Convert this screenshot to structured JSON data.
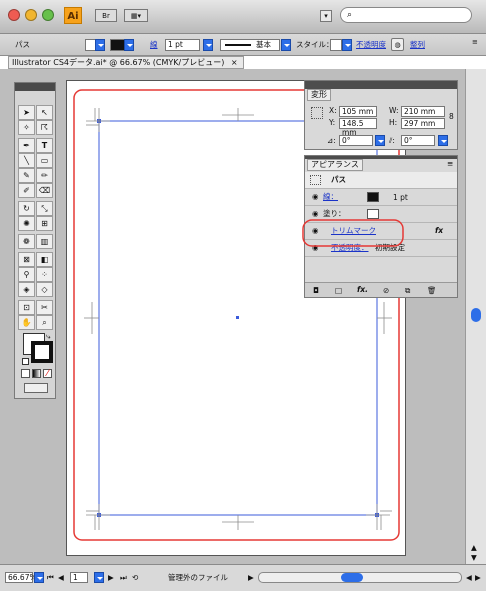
{
  "title_bar": {
    "app_icon_label": "Ai",
    "search_glyph": "⌕",
    "icons": [
      "close-light",
      "minimize-light",
      "zoom-light",
      "bridge-icon",
      "arrange-documents-icon",
      "search-icon"
    ]
  },
  "control_bar": {
    "object_type": "パス",
    "stroke_link": "線",
    "stroke_weight": "1 pt",
    "brush_label": "基本",
    "style_label": "スタイル：",
    "opacity_link": "不透明度",
    "recolor_link": "整列"
  },
  "document": {
    "tab_title": "Illustrator CS4データ.ai* @ 66.67% (CMYK/プレビュー)",
    "tab_close": "×"
  },
  "transform_panel": {
    "tab_label": "変形",
    "x_label": "X:",
    "x_value": "105 mm",
    "y_label": "Y:",
    "y_value": "148.5 mm",
    "w_label": "W:",
    "w_value": "210 mm",
    "h_label": "H:",
    "h_value": "297 mm",
    "angle_value": "0°",
    "shear_value": "0°"
  },
  "appearance_panel": {
    "tab_label": "アピアランス",
    "object_label": "パス",
    "stroke_label": "線：",
    "stroke_weight": "1 pt",
    "fill_label": "塗り：",
    "effect_label": "トリムマーク",
    "effect_fx": "fx",
    "opacity_label": "不透明度：",
    "opacity_value": "初期設定",
    "footer_fx": "fx."
  },
  "status_bar": {
    "zoom": "66.67%",
    "page": "1",
    "status_text": "管理外のファイル"
  },
  "colors": {
    "highlight": "#e53935",
    "artboard_guide": "#3b5bdb",
    "link": "#1a33c8",
    "accent_blue": "#2d6ee8"
  }
}
